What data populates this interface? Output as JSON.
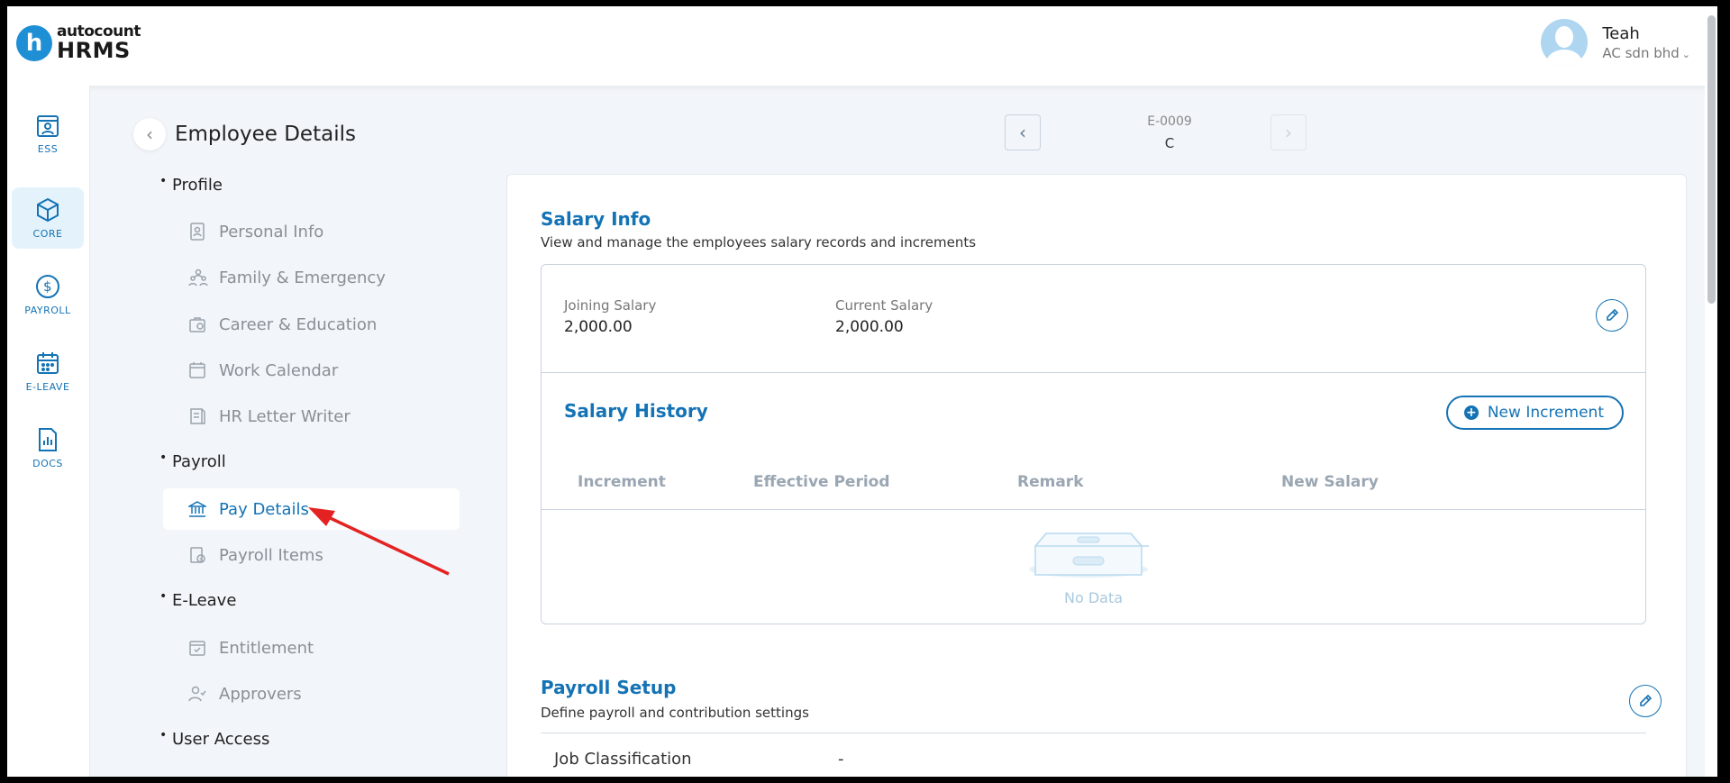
{
  "header": {
    "logo_small": "autocount",
    "logo_big": "HRMS",
    "logo_mark": "h",
    "user_name": "Teah",
    "company": "AC sdn bhd"
  },
  "rail": {
    "items": [
      {
        "label": "ESS",
        "icon": "ess-icon"
      },
      {
        "label": "CORE",
        "icon": "core-icon"
      },
      {
        "label": "PAYROLL",
        "icon": "payroll-icon"
      },
      {
        "label": "E-LEAVE",
        "icon": "calendar-icon"
      },
      {
        "label": "DOCS",
        "icon": "docs-icon"
      }
    ]
  },
  "page": {
    "title": "Employee Details",
    "emp_code": "E-0009",
    "emp_name": "C"
  },
  "nav": {
    "sections": [
      "Profile",
      "Payroll",
      "E-Leave",
      "User Access"
    ],
    "profile_items": [
      "Personal Info",
      "Family & Emergency",
      "Career & Education",
      "Work Calendar",
      "HR Letter Writer"
    ],
    "payroll_items": [
      "Pay Details",
      "Payroll Items"
    ],
    "eleave_items": [
      "Entitlement",
      "Approvers"
    ]
  },
  "salary_info": {
    "title": "Salary Info",
    "subtitle": "View and manage the employees salary records and increments",
    "joining_label": "Joining Salary",
    "joining_value": "2,000.00",
    "current_label": "Current Salary",
    "current_value": "2,000.00"
  },
  "salary_history": {
    "title": "Salary History",
    "new_button": "New Increment",
    "columns": [
      "Increment",
      "Effective Period",
      "Remark",
      "New Salary"
    ],
    "empty_text": "No Data"
  },
  "payroll_setup": {
    "title": "Payroll Setup",
    "subtitle": "Define payroll and contribution settings",
    "job_label": "Job Classification",
    "job_value": "-"
  },
  "colors": {
    "accent": "#1473b5",
    "annotation": "#e52222"
  }
}
